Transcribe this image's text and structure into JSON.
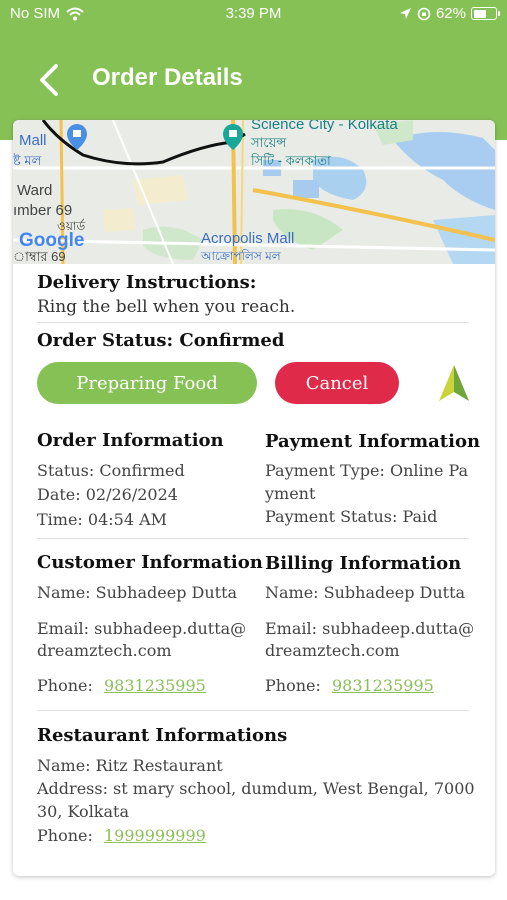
{
  "status_bar": {
    "carrier": "No SIM",
    "time": "3:39 PM",
    "battery": "62%",
    "battery_level": 0.62
  },
  "nav": {
    "title": "Order Details"
  },
  "map": {
    "labels": {
      "science_city": "Science City - Kolkata",
      "science_city_bn_1": "সায়েন্স",
      "science_city_bn_2": "সিটি - কলকাতা",
      "mall": "Mall",
      "mall_bn": "ষ্ট মল",
      "ward": "Ward",
      "ward_number": "ımber 69",
      "ward_bn": "াম্বার 69",
      "acropolis": "Acropolis Mall",
      "acropolis_bn": "আক্রোপলিস মল",
      "bn_partial": "ওয়ার্ড",
      "google": "Google"
    }
  },
  "delivery": {
    "heading": "Delivery Instructions:",
    "text": "Ring the bell when you reach."
  },
  "order_status": {
    "heading": "Order Status: Confirmed"
  },
  "actions": {
    "preparing": "Preparing Food",
    "cancel": "Cancel"
  },
  "order_info": {
    "heading": "Order Information",
    "status": "Status: Confirmed",
    "date": "Date: 02/26/2024",
    "time": "Time: 04:54 AM"
  },
  "payment_info": {
    "heading": "Payment Information",
    "type_line1": "Payment Type: Online Pa",
    "type_line2": "yment",
    "status": "Payment Status: Paid"
  },
  "customer_info": {
    "heading": "Customer Information",
    "name": "Name: Subhadeep Dutta",
    "email_line1": "Email: subhadeep.dutta@",
    "email_line2": "dreamztech.com",
    "phone_label": "Phone:",
    "phone": "9831235995"
  },
  "billing_info": {
    "heading": "Billing Information",
    "name": "Name: Subhadeep Dutta",
    "email_line1": "Email: subhadeep.dutta@",
    "email_line2": "dreamztech.com",
    "phone_label": "Phone:",
    "phone": "9831235995"
  },
  "restaurant_info": {
    "heading": "Restaurant Informations",
    "name": "Name: Ritz Restaurant",
    "address_line1": "Address: st mary school, dumdum, West Bengal, 7000",
    "address_line2": "30, Kolkata",
    "phone_label": "Phone:",
    "phone": "1999999999"
  },
  "colors": {
    "brand_green": "#86c155",
    "cancel_red": "#e02a4a",
    "link_green": "#8bbf57"
  }
}
